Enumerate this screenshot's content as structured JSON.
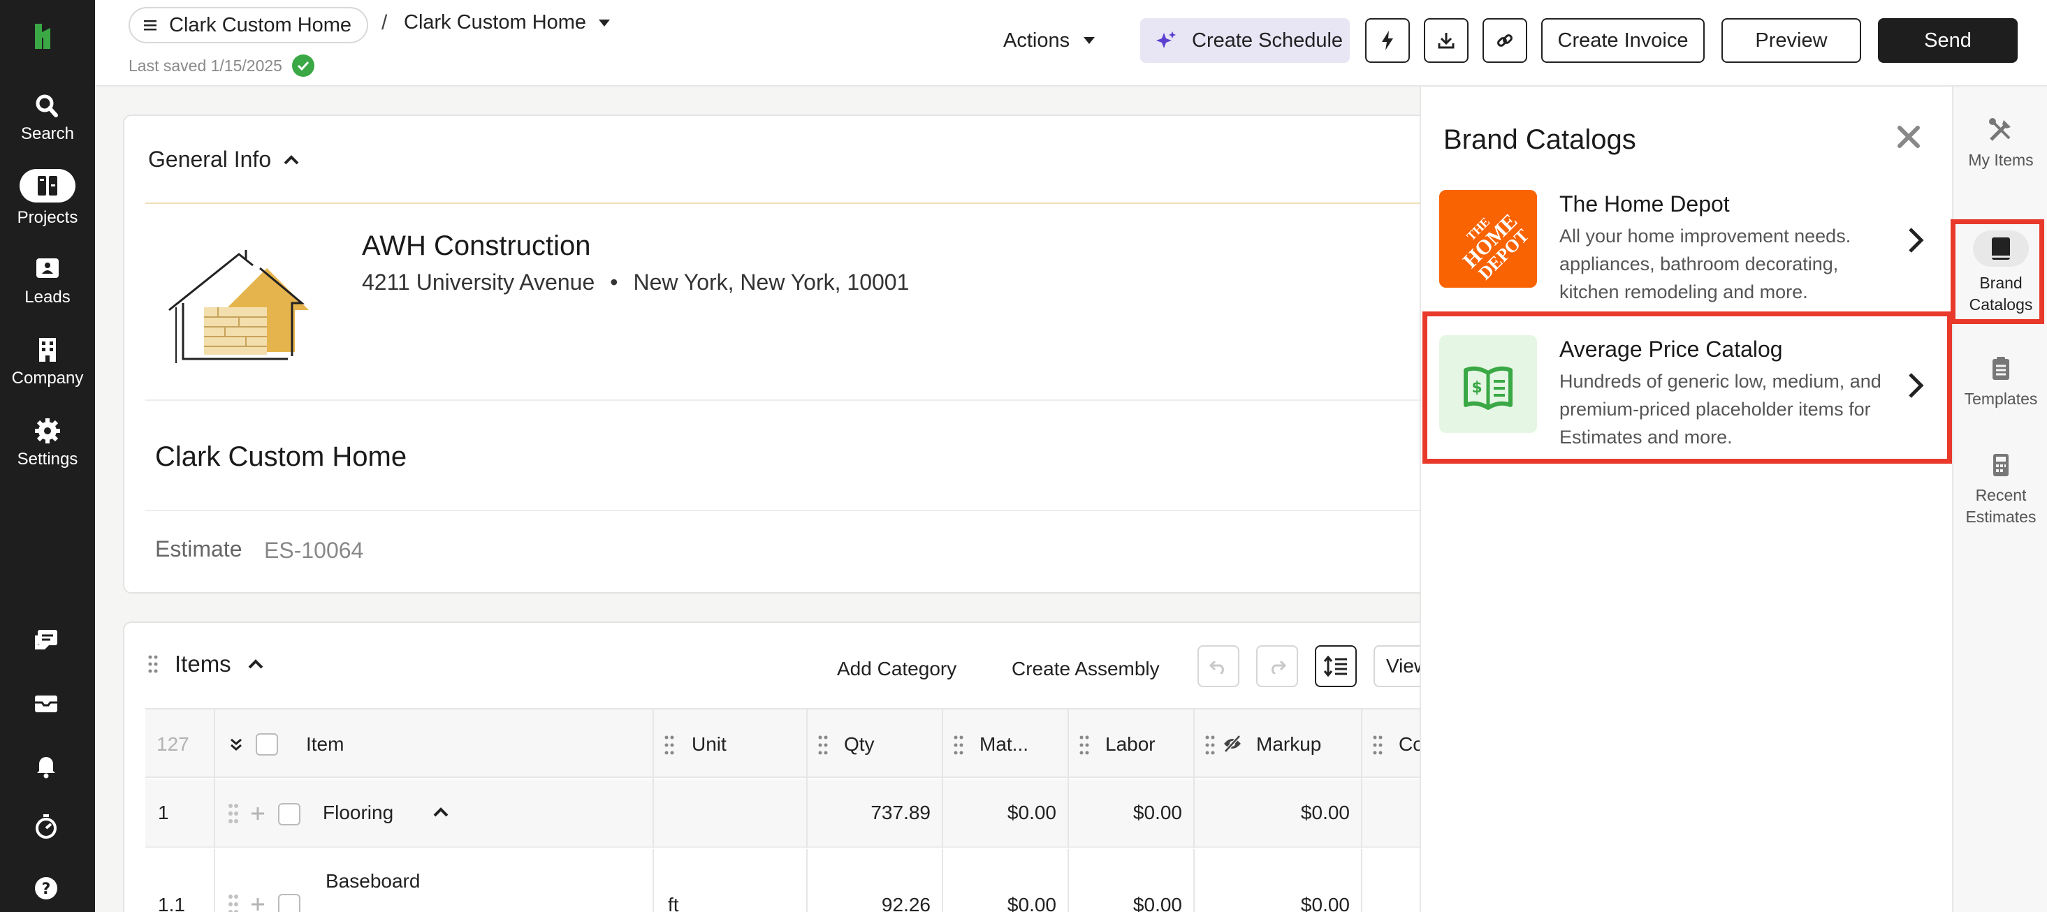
{
  "nav": {
    "items": [
      {
        "label": "Search",
        "icon": "search-icon"
      },
      {
        "label": "Projects",
        "icon": "projects-icon",
        "active": true
      },
      {
        "label": "Leads",
        "icon": "leads-icon"
      },
      {
        "label": "Company",
        "icon": "company-icon"
      },
      {
        "label": "Settings",
        "icon": "gear-icon"
      }
    ],
    "bottom_icons": [
      "chat-icon",
      "inbox-icon",
      "bell-icon",
      "timer-icon",
      "help-icon"
    ]
  },
  "header": {
    "project_breadcrumb": "Clark Custom Home",
    "document_breadcrumb": "Clark Custom Home",
    "last_saved": "Last saved 1/15/2025",
    "actions_label": "Actions",
    "create_schedule_label": "Create Schedule",
    "create_invoice_label": "Create Invoice",
    "preview_label": "Preview",
    "send_label": "Send"
  },
  "general_info": {
    "title": "General Info",
    "company_name": "AWH Construction",
    "street": "4211 University Avenue",
    "bullet": "•",
    "city_state_zip": "New York, New York, 10001",
    "project_name": "Clark Custom Home",
    "estimate_label": "Estimate",
    "estimate_number": "ES-10064"
  },
  "items": {
    "title": "Items",
    "add_category_label": "Add Category",
    "create_assembly_label": "Create Assembly",
    "view_label": "View",
    "columns": {
      "count": "127",
      "item": "Item",
      "unit": "Unit",
      "qty": "Qty",
      "materials": "Mat...",
      "labor": "Labor",
      "markup": "Markup",
      "cost": "Co"
    },
    "rows": [
      {
        "num": "1",
        "item": "Flooring",
        "unit": "",
        "qty": "737.89",
        "materials": "$0.00",
        "labor": "$0.00",
        "markup": "$0.00"
      },
      {
        "num": "1.1",
        "item": "Baseboard",
        "unit": "ft",
        "qty": "92.26",
        "materials": "$0.00",
        "labor": "$0.00",
        "markup": "$0.00"
      }
    ]
  },
  "brand_catalogs": {
    "title": "Brand Catalogs",
    "catalogs": [
      {
        "name": "The Home Depot",
        "description": "All your home improvement needs. appliances, bathroom decorating, kitchen remodeling and more.",
        "logo_text": "THE HOME DEPOT",
        "brand_color": "#f96302"
      },
      {
        "name": "Average Price Catalog",
        "description": "Hundreds of generic low, medium, and premium-priced placeholder items for Estimates and more.",
        "icon_color": "#3aa845"
      }
    ]
  },
  "right_rail": [
    {
      "label": "My Items",
      "icon": "tools-icon"
    },
    {
      "label": "Brand Catalogs",
      "icon": "book-icon",
      "active": true
    },
    {
      "label": "Templates",
      "icon": "clipboard-icon"
    },
    {
      "label": "Recent Estimates",
      "icon": "calculator-icon"
    }
  ],
  "colors": {
    "accent_green": "#3aa845",
    "highlight_red": "#e8392a",
    "home_depot_orange": "#f96302",
    "dark": "#1e1e1e"
  }
}
